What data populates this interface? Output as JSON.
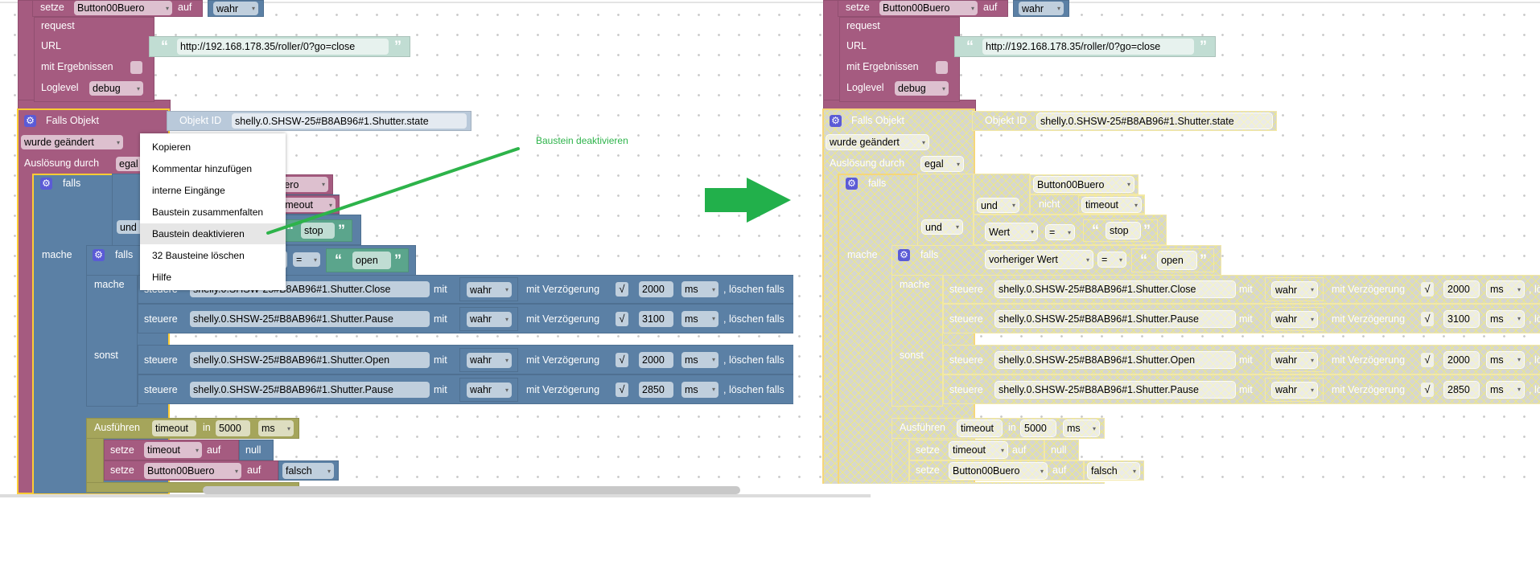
{
  "program": {
    "set_top": {
      "verb": "setze",
      "var": "Button00Buero",
      "to": "auf",
      "value": "wahr"
    },
    "request": {
      "title": "request",
      "url_label": "URL",
      "url": "http://192.168.178.35/roller/0?go=close",
      "results_label": "mit Ergebnissen",
      "results_checked": false,
      "loglevel_label": "Loglevel",
      "loglevel": "debug"
    },
    "trigger": {
      "title": "Falls Objekt",
      "objid_label": "Objekt ID",
      "objid": "shelly.0.SHSW-25#B8AB96#1.Shutter.state",
      "event": "wurde geändert",
      "by_label": "Auslösung durch",
      "by": "egal"
    },
    "if1": {
      "label": "falls",
      "var": "Button00Buero",
      "and1": "und",
      "not": "nicht",
      "var2": "timeout",
      "and2": "und",
      "value": "Wert",
      "op": "=",
      "str": "stop",
      "do": "mache"
    },
    "if2": {
      "label": "falls",
      "prev": "vorheriger Wert",
      "op": "=",
      "str": "open",
      "do": "mache",
      "else": "sonst"
    },
    "actions": [
      {
        "verb": "steuere",
        "id": "shelly.0.SHSW-25#B8AB96#1.Shutter.Close",
        "with": "mit",
        "value": "wahr",
        "delay_label": "mit Verzögerung",
        "delay_checked": true,
        "delay": "2000",
        "unit": "ms",
        "clear_label": ", löschen falls"
      },
      {
        "verb": "steuere",
        "id": "shelly.0.SHSW-25#B8AB96#1.Shutter.Pause",
        "with": "mit",
        "value": "wahr",
        "delay_label": "mit Verzögerung",
        "delay_checked": true,
        "delay": "3100",
        "unit": "ms",
        "clear_label": ", löschen falls"
      },
      {
        "verb": "steuere",
        "id": "shelly.0.SHSW-25#B8AB96#1.Shutter.Open",
        "with": "mit",
        "value": "wahr",
        "delay_label": "mit Verzögerung",
        "delay_checked": true,
        "delay": "2000",
        "unit": "ms",
        "clear_label": ", löschen falls"
      },
      {
        "verb": "steuere",
        "id": "shelly.0.SHSW-25#B8AB96#1.Shutter.Pause",
        "with": "mit",
        "value": "wahr",
        "delay_label": "mit Verzögerung",
        "delay_checked": true,
        "delay": "2850",
        "unit": "ms",
        "clear_label": ", löschen falls"
      }
    ],
    "timeout": {
      "label": "Ausführen",
      "var": "timeout",
      "in": "in",
      "value": "5000",
      "unit": "ms",
      "set1": {
        "verb": "setze",
        "var": "timeout",
        "to": "auf",
        "value": "null"
      },
      "set2": {
        "verb": "setze",
        "var": "Button00Buero",
        "to": "auf",
        "value": "falsch"
      }
    }
  },
  "context_menu": {
    "items": [
      "Kopieren",
      "Kommentar hinzufügen",
      "interne Eingänge",
      "Baustein zusammenfalten",
      "Baustein deaktivieren",
      "32 Bausteine löschen",
      "Hilfe"
    ],
    "highlighted_index": 4
  },
  "annotation": {
    "text": "Baustein deaktivieren"
  },
  "colors": {
    "logic": "#5b80a5",
    "variables": "#a55b80",
    "timeouts": "#a5a55b",
    "text": "#5ba58c",
    "selection": "#ffcc33",
    "annotation": "#2db34a",
    "arrow": "#22b04b"
  },
  "icons": {
    "block_settings": "gear-icon",
    "dropdown": "dropdown-arrow-icon",
    "quotes": "quote-icon",
    "arrow": "arrow-right-icon"
  }
}
